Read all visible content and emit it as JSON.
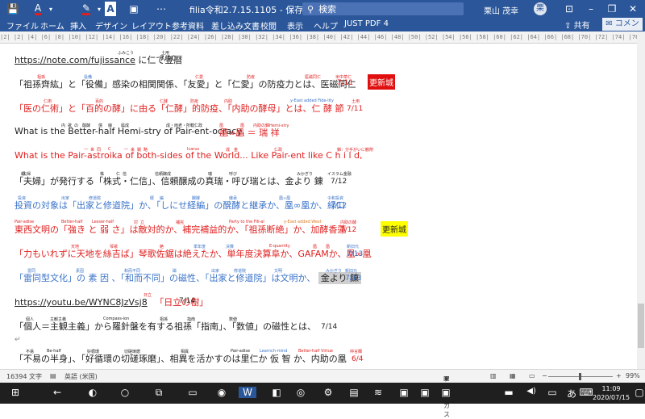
{
  "app": {
    "title": "filia令和2.7.15.1105 - 保存済み",
    "search_placeholder": "検索",
    "user_name": "栗山 茂幸",
    "user_initial": "栗",
    "accent": "#2b579a"
  },
  "toolbar": {
    "font_color_glyph": "A",
    "highlight_glyph": "A",
    "clear_glyph": "A",
    "more_glyph": "⋯"
  },
  "ribbon": {
    "tabs": [
      "ファイル",
      "ホーム",
      "挿入",
      "デザイン",
      "レイアウト",
      "参考資料",
      "差し込み文書",
      "校閲",
      "表示",
      "ヘルプ",
      "JUST PDF 4"
    ],
    "share": "共有",
    "comment": "コメント"
  },
  "ruler": {
    "text": "|2| |2| |4| |6| |8| |10| |12| |14| |16| |18| |20| |22| |24| |26| |28| |30| |32| |34| |36| |38| |40| |42| |44| |46| |48| |50| |52| |54| |56| |58| |60| |62| |64| |66| |68| |70| |72| |74| |76| |78| |80|"
  },
  "doc": {
    "l1": {
      "link": "https://note.com/fujissance",
      "tail": "に仁で登暦",
      "date": "7/10",
      "ruby": [
        "ふみこう",
        "土用"
      ]
    },
    "l2": {
      "text": "「祖孫齊紘」と「役備」感染の相関関係、「友愛」と「仁愛」の防疫力とは、医磁同仁",
      "date": "7/11",
      "badge": "更新城",
      "ruby": [
        "祖孫",
        "役備",
        "仁愛",
        "防疫",
        "医磁同仁",
        "米中草仁"
      ]
    },
    "l3": {
      "text": "「医の仁術」と「百的の酵」に由る「仁酵」的防疫、「内助の酵母」とは、仁 酵 節",
      "date": "7/11",
      "ruby": [
        "仁術",
        "百的",
        "仁酵",
        "防疫",
        "内助",
        "y-East added Fide-lity",
        "土用"
      ]
    },
    "l4": {
      "text": "What is the  Better-half  Hemi-stry  of  Pair-ent-ocracy,",
      "kanji": "凰∞凰 ＝ 瑞 祥",
      "ruby": [
        "内",
        "歌",
        "の",
        "酸酵",
        "億",
        "娘",
        "属成",
        "成・両老・所轄仁政",
        "凰",
        "凰",
        "内助の錦Hemi-stry"
      ]
    },
    "l5": {
      "text": "What is the  Pair-astroika  of  both-sides  of the  World... Like  Pair-ent  like  C h i l d,",
      "ruby": [
        "一",
        "世",
        "同",
        "C",
        "一",
        "来",
        "戦",
        "略",
        "Icarus",
        "成",
        "金",
        "仁政",
        "錦：分手がいに観剤",
        "Addy-East"
      ]
    },
    "l6": {
      "text": "「夫婦」が発行する「株式・仁信」、信頼醸成の真瑞・呼び瑞とは、金より 錬",
      "date": "7/12",
      "ruby": [
        "頼",
        "夫婦",
        "株",
        "仁",
        "信",
        "信頼醸成",
        "瑞",
        "呼び",
        "みかぎり",
        "イスラム金融"
      ]
    },
    "l7": {
      "text": "投資の対象は「出家と修道院」か、「しにせ経編」の醗酵と継承か、凰∞凰か、緑口",
      "date": "7/12",
      "ruby": [
        "投資",
        "出家",
        "修道院",
        "経",
        "編",
        "醗酵",
        "継承",
        "凰∞凰",
        "令和投資"
      ]
    },
    "l8": {
      "text": "東西文明の「強き と 弱 さ」は敵対的か、補完補益的か、「祖孫断絶」か、加酵香蓮",
      "date": "7/12",
      "badge": "更新城",
      "ruby": [
        "Pair-adise",
        "Better-half",
        "Lesser-half",
        "対",
        "立",
        "補完",
        "Party to the Fili-al",
        "y-East added West",
        "内助の酵"
      ]
    },
    "l9": {
      "text": "「力もいれずに天地を絲吉ば」琴歌佐鋸は絶えたか、単年度決算阜か、GAFAMか、凰∞凰",
      "date": "7/13",
      "ruby": [
        "天地",
        "琴歌",
        "絶",
        "単年度",
        "決算",
        "E-quantity",
        "凰",
        "凰",
        "新旧元"
      ]
    },
    "l10": {
      "text": "「雷同型文化」の 素 因 、「和而不同」の磁性、「出家と修道院」は文明か、",
      "hl": "金より 錬",
      "date": "7/13",
      "ruby": [
        "雷同",
        "素因",
        "和而不同",
        "磁",
        "出家",
        "修道院",
        "文明",
        "みかぎり",
        "新旧元"
      ]
    },
    "l11": {
      "link": "https://youtu.be/WYNC8JzVsj8",
      "tail": "「日立の樹」",
      "date": "7/14",
      "ruby": [
        "日立"
      ]
    },
    "l12": {
      "text": "「個人＝主観主義」から羅針盤を有する祖孫「指南」、「数値」の磁性とは、",
      "date": "7/14",
      "ruby": [
        "個人",
        "主観主義",
        "Compass-ion",
        "祖孫",
        "指南",
        "数値"
      ]
    },
    "l13": {
      "text": "「不易の半身」、「好循環の切磋琢磨」、相異を活かすのは里仁か 仮 智 か、内助の凰",
      "date": "6/4",
      "ruby": [
        "不易",
        "Be-half",
        "好循環",
        "切磋琢磨",
        "相異",
        "Pair-adise",
        "Learnch-mind",
        "Better-half Virtue",
        "仲言欄"
      ]
    }
  },
  "status": {
    "word_count": "16394 文字",
    "language": "英語 (米国)",
    "focus": "フォーカス",
    "zoom": "99%"
  },
  "taskbar": {
    "time": "11:09",
    "date": "2020/07/15",
    "ime": "あ"
  }
}
